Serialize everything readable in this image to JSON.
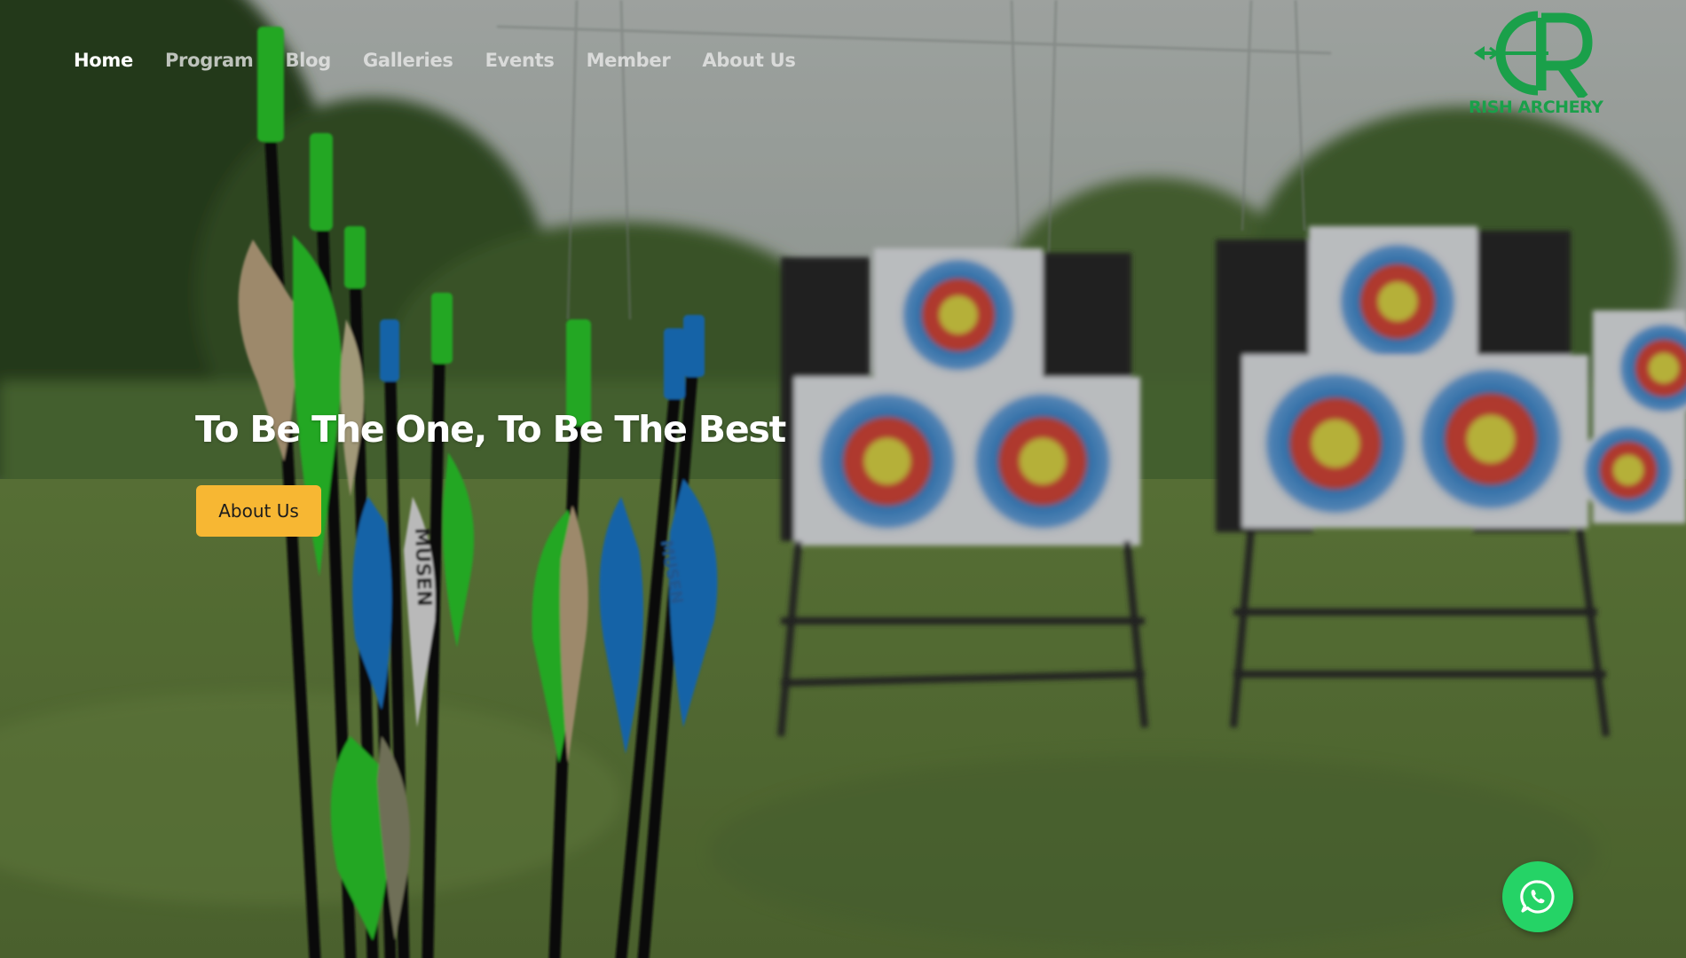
{
  "nav": {
    "items": [
      {
        "label": "Home",
        "active": true
      },
      {
        "label": "Program",
        "active": false
      },
      {
        "label": "Blog",
        "active": false
      },
      {
        "label": "Galleries",
        "active": false
      },
      {
        "label": "Events",
        "active": false
      },
      {
        "label": "Member",
        "active": false
      },
      {
        "label": "About Us",
        "active": false
      }
    ]
  },
  "logo": {
    "text": "RISH ARCHERY",
    "icon": "bow-arrow-logo-icon",
    "color": "#1aa04a"
  },
  "hero": {
    "headline": "To Be The One, To Be The Best",
    "cta_label": "About Us",
    "cta_color": "#f7b733",
    "background": "archery-field-photo"
  },
  "floating": {
    "whatsapp_icon": "whatsapp-icon",
    "color": "#25d366"
  }
}
